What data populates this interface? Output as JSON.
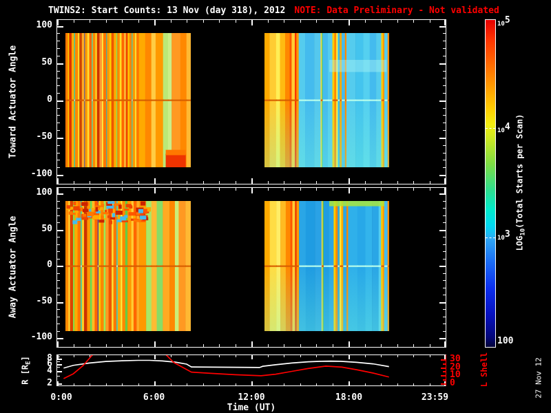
{
  "title": {
    "main": "TWINS2: Start Counts: 13 Nov (day 318), 2012",
    "note": "NOTE: Data Preliminary - Not validated"
  },
  "colors": {
    "axis": "#ffffff",
    "note_red": "#ff0000",
    "lshell_red": "#ff0000",
    "background": "#000000"
  },
  "panels": [
    {
      "id": "toward",
      "ylabel": "Toward Actuator Angle",
      "yticks": [
        100,
        50,
        0,
        -50,
        -100
      ]
    },
    {
      "id": "away",
      "ylabel": "Away Actuator Angle",
      "yticks": [
        100,
        50,
        0,
        -50,
        -100
      ]
    }
  ],
  "bottom_panel": {
    "r_label_pre": "R [R",
    "r_label_sub": "E",
    "r_label_post": "]",
    "yticks_left": [
      8,
      6,
      4,
      2
    ],
    "ylabel_right": "L Shell",
    "yticks_right": [
      30,
      20,
      10,
      0
    ]
  },
  "xaxis": {
    "label": "Time (UT)",
    "tick_labels": [
      "0:00",
      "6:00",
      "12:00",
      "18:00",
      "23:59"
    ],
    "label_hours": [
      0.3,
      6,
      12,
      18,
      23.3
    ]
  },
  "colorbar": {
    "label_pre": "LOG",
    "label_sub": "10",
    "label_post": "(Total Starts per Scan)",
    "ticks": [
      {
        "base": "10",
        "exp": "5",
        "pos": 0
      },
      {
        "base": "10",
        "exp": "4",
        "pos": 0.333
      },
      {
        "base": "10",
        "exp": "3",
        "pos": 0.667
      },
      {
        "text": "100",
        "pos": 1
      }
    ],
    "gradient": [
      [
        0,
        "#e60000"
      ],
      [
        0.06,
        "#ff3300"
      ],
      [
        0.13,
        "#ff6600"
      ],
      [
        0.2,
        "#ff9900"
      ],
      [
        0.27,
        "#ffcc00"
      ],
      [
        0.32,
        "#f2ee11"
      ],
      [
        0.36,
        "#cfe922"
      ],
      [
        0.44,
        "#7edd44"
      ],
      [
        0.52,
        "#2ede8e"
      ],
      [
        0.58,
        "#00eccc"
      ],
      [
        0.63,
        "#00d8f2"
      ],
      [
        0.67,
        "#2fa8f5"
      ],
      [
        0.74,
        "#1b6df5"
      ],
      [
        0.82,
        "#0c2fee"
      ],
      [
        0.9,
        "#0712c0"
      ],
      [
        0.97,
        "#04077a"
      ],
      [
        1,
        "#020338"
      ]
    ]
  },
  "date_stamp": "27 Nov 12",
  "chart_data": [
    {
      "type": "heatmap",
      "panel": "toward",
      "title": "Toward Actuator Angle vs Time, LOG10(Total Starts per Scan)",
      "x_range_hours": [
        0,
        24
      ],
      "angle_range": [
        90,
        -90
      ],
      "value_scale": {
        "min": 100,
        "max": 100000,
        "scale": "log10"
      },
      "blocks": [
        {
          "t_start": 0.5,
          "t_end": 8.25,
          "features": [
            "zero-line",
            "red-blob-br"
          ],
          "stripes": [
            [
              "#ff7700",
              2
            ],
            [
              "#ffcc00",
              1
            ],
            [
              "#dd3300",
              2
            ],
            [
              "#ffaa00",
              2
            ],
            [
              "#33ccaa",
              0.8
            ],
            [
              "#ff8800",
              2.5
            ],
            [
              "#ffee33",
              1
            ],
            [
              "#cc4400",
              2
            ],
            [
              "#ffaa22",
              2
            ],
            [
              "#2244cc",
              0.5
            ],
            [
              "#ff9900",
              2
            ],
            [
              "#ffdd33",
              1.5
            ],
            [
              "#ff6600",
              2
            ],
            [
              "#55ddaa",
              0.8
            ],
            [
              "#ff8800",
              2
            ],
            [
              "#ffcc22",
              1.5
            ],
            [
              "#cc3300",
              2
            ],
            [
              "#ff9933",
              2
            ],
            [
              "#ffee44",
              1
            ],
            [
              "#ff7700",
              2.5
            ],
            [
              "#22bbcc",
              0.6
            ],
            [
              "#ff9900",
              2
            ],
            [
              "#ffcc00",
              1.5
            ],
            [
              "#ee5500",
              2
            ],
            [
              "#ffaa00",
              2
            ],
            [
              "#88dd55",
              0.8
            ],
            [
              "#ff8800",
              2
            ],
            [
              "#ffdd22",
              1.5
            ],
            [
              "#ff6600",
              2
            ],
            [
              "#ffbb33",
              1.5
            ],
            [
              "#ee4400",
              1.5
            ],
            [
              "#ffcc00",
              1.2
            ],
            [
              "#ff8800",
              2
            ],
            [
              "#44ccbb",
              0.7
            ],
            [
              "#ff9900",
              2
            ],
            [
              "#ffdd33",
              1.2
            ],
            [
              "#ff7700",
              2
            ],
            [
              "#ffaa00",
              5
            ],
            [
              "#ff8800",
              5
            ],
            [
              "#ffcc44",
              3.5
            ],
            [
              "#ff9900",
              6
            ],
            [
              "#bbe877",
              4
            ],
            [
              "#ccee88",
              3
            ],
            [
              "#ff9922",
              7
            ],
            [
              "#ff8800",
              5
            ],
            [
              "#ffb833",
              3.5
            ]
          ]
        },
        {
          "t_start": 12.8,
          "t_end": 20.5,
          "features": [
            "zero-line",
            "bottom-cyan-tint",
            "light-band-right"
          ],
          "stripes": [
            [
              "#ffaa00",
              4
            ],
            [
              "#ffcc33",
              5
            ],
            [
              "#ffee55",
              3
            ],
            [
              "#ffbb11",
              4
            ],
            [
              "#ff8800",
              3.5
            ],
            [
              "#ff5500",
              1.5
            ],
            [
              "#ffcc33",
              2.5
            ],
            [
              "#ff3300",
              1.2
            ],
            [
              "#ff9900",
              1.8
            ],
            [
              "#55ccee",
              5
            ],
            [
              "#44bbee",
              7
            ],
            [
              "#55c8ee",
              5
            ],
            [
              "#ffdd44",
              0.8
            ],
            [
              "#66cc66",
              0.8
            ],
            [
              "#44bbee",
              4
            ],
            [
              "#55ccee",
              3.5
            ],
            [
              "#ffcc00",
              1.5
            ],
            [
              "#ff8800",
              1.5
            ],
            [
              "#ffee44",
              1.2
            ],
            [
              "#33bbee",
              1.5
            ],
            [
              "#ffaa00",
              1.5
            ],
            [
              "#44bbee",
              2.5
            ],
            [
              "#ff8800",
              1.2
            ],
            [
              "#55ccee",
              7
            ],
            [
              "#44c4ee",
              6
            ],
            [
              "#55d0f0",
              5
            ],
            [
              "#44bbee",
              5
            ],
            [
              "#55ccee",
              4
            ],
            [
              "#ffcc00",
              1.2
            ],
            [
              "#ff9900",
              1.2
            ],
            [
              "#55ccee",
              2.5
            ],
            [
              "#ff8800",
              1.2
            ]
          ]
        }
      ]
    },
    {
      "type": "heatmap",
      "panel": "away",
      "title": "Away Actuator Angle vs Time, LOG10(Total Starts per Scan)",
      "x_range_hours": [
        0,
        24
      ],
      "angle_range": [
        90,
        -90
      ],
      "value_scale": {
        "min": 100,
        "max": 100000,
        "scale": "log10"
      },
      "blocks": [
        {
          "t_start": 0.5,
          "t_end": 8.25,
          "features": [
            "zero-line",
            "top-mottle"
          ],
          "stripes": [
            [
              "#ff8800",
              2
            ],
            [
              "#ffdd33",
              1
            ],
            [
              "#dd4400",
              2
            ],
            [
              "#88dd44",
              1
            ],
            [
              "#ffaa00",
              2
            ],
            [
              "#ff7700",
              2
            ],
            [
              "#33ccaa",
              0.8
            ],
            [
              "#ffcc22",
              1.5
            ],
            [
              "#cc3300",
              2
            ],
            [
              "#ff9900",
              2
            ],
            [
              "#66dd55",
              1.2
            ],
            [
              "#ffbb22",
              1.8
            ],
            [
              "#ff6600",
              2
            ],
            [
              "#2233cc",
              0.5
            ],
            [
              "#ffcc00",
              1.5
            ],
            [
              "#ff8800",
              2
            ],
            [
              "#99ee55",
              1.2
            ],
            [
              "#ff9922",
              2
            ],
            [
              "#ee5500",
              2
            ],
            [
              "#ffdd33",
              1.2
            ],
            [
              "#ff7700",
              2
            ],
            [
              "#44ccbb",
              0.8
            ],
            [
              "#ffaa00",
              2
            ],
            [
              "#ffee44",
              1
            ],
            [
              "#ff8800",
              2
            ],
            [
              "#66cc44",
              1.5
            ],
            [
              "#ff9900",
              2.5
            ],
            [
              "#ffcc33",
              1.5
            ],
            [
              "#ff6600",
              2
            ],
            [
              "#ffaa22",
              1.8
            ],
            [
              "#ff9900",
              4.5
            ],
            [
              "#aae866",
              3.5
            ],
            [
              "#ffbb33",
              3.5
            ],
            [
              "#88dd66",
              4
            ],
            [
              "#ffaa22",
              4.5
            ],
            [
              "#ff8800",
              3.5
            ],
            [
              "#ccee77",
              2.5
            ],
            [
              "#ff9922",
              4.5
            ],
            [
              "#ffb833",
              3.5
            ]
          ]
        },
        {
          "t_start": 12.8,
          "t_end": 20.5,
          "features": [
            "zero-line",
            "bottom-cyan-tint",
            "top-green-fringe"
          ],
          "stripes": [
            [
              "#ffaa00",
              4
            ],
            [
              "#ffdd44",
              5
            ],
            [
              "#ffee66",
              3
            ],
            [
              "#ffbb22",
              4
            ],
            [
              "#ff8800",
              3.5
            ],
            [
              "#ff5500",
              1.5
            ],
            [
              "#ffcc33",
              2
            ],
            [
              "#ee3300",
              1.2
            ],
            [
              "#ff9900",
              1.8
            ],
            [
              "#2aa6e6",
              5
            ],
            [
              "#1f9ce2",
              7
            ],
            [
              "#2aa2e6",
              5
            ],
            [
              "#ffdd44",
              0.8
            ],
            [
              "#55bb55",
              0.8
            ],
            [
              "#1f9ce2",
              4
            ],
            [
              "#2aa6e6",
              3.5
            ],
            [
              "#ffcc00",
              1.5
            ],
            [
              "#ff8800",
              1.5
            ],
            [
              "#33aadd",
              1.5
            ],
            [
              "#ffee44",
              1.2
            ],
            [
              "#ffaa00",
              1.5
            ],
            [
              "#2aa6e6",
              2.5
            ],
            [
              "#ff8800",
              1.2
            ],
            [
              "#2fb0ea",
              7
            ],
            [
              "#28a8e8",
              6
            ],
            [
              "#33b4ec",
              5
            ],
            [
              "#2aa6e6",
              5
            ],
            [
              "#55ccee",
              1.8
            ],
            [
              "#ffcc00",
              1.2
            ],
            [
              "#ff9900",
              1.2
            ],
            [
              "#44bbee",
              2.5
            ],
            [
              "#ff8800",
              1.2
            ]
          ]
        }
      ]
    },
    {
      "type": "line",
      "panel": "orbit",
      "x_domain": [
        0,
        24
      ],
      "series": [
        {
          "name": "R [RE]",
          "color": "#ffffff",
          "axis": "left",
          "scale": "log10",
          "domain": [
            1.75,
            9.8
          ],
          "points": [
            [
              0.4,
              4.7
            ],
            [
              1,
              5.5
            ],
            [
              2,
              6.3
            ],
            [
              3,
              6.85
            ],
            [
              4,
              7.15
            ],
            [
              5,
              7.3
            ],
            [
              5.7,
              7.3
            ],
            [
              6.5,
              7.05
            ],
            [
              7.3,
              6.6
            ],
            [
              8,
              5.9
            ],
            [
              8.3,
              5.0
            ],
            [
              12.5,
              4.85
            ],
            [
              12.7,
              5.2
            ],
            [
              13.5,
              5.7
            ],
            [
              14.5,
              6.3
            ],
            [
              15.5,
              6.7
            ],
            [
              16.3,
              6.95
            ],
            [
              16.9,
              7.0
            ],
            [
              17.5,
              6.9
            ],
            [
              18.5,
              6.55
            ],
            [
              19.5,
              6.0
            ],
            [
              20.5,
              5.1
            ]
          ]
        },
        {
          "name": "L Shell",
          "color": "#ff0000",
          "axis": "right",
          "scale": "linear",
          "domain": [
            -2.4,
            34.9
          ],
          "points": [
            [
              0.4,
              6
            ],
            [
              1.0,
              12
            ],
            [
              1.6,
              22
            ],
            [
              2.3,
              38
            ],
            [
              6.6,
              38
            ],
            [
              7.2,
              26
            ],
            [
              8.3,
              14
            ],
            [
              9.5,
              12.5
            ],
            [
              11,
              10.8
            ],
            [
              12.6,
              9.5
            ],
            [
              13.5,
              11.5
            ],
            [
              14.5,
              15
            ],
            [
              15.5,
              18.5
            ],
            [
              16.6,
              21.5
            ],
            [
              17.6,
              20.2
            ],
            [
              18.5,
              17
            ],
            [
              19.5,
              13
            ],
            [
              20.5,
              8
            ]
          ]
        }
      ]
    }
  ]
}
